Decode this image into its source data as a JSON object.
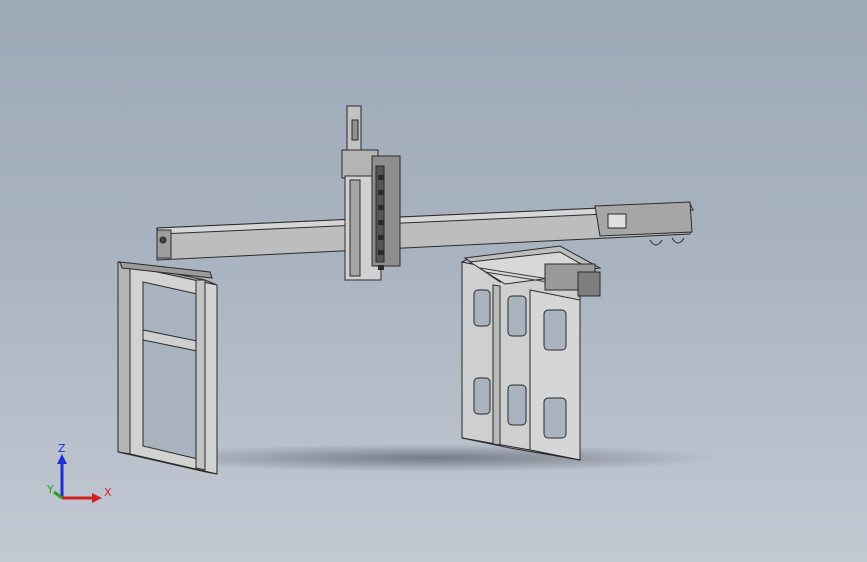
{
  "view": {
    "background_top": "#9ea9b7",
    "background_bottom": "#c3c9d3",
    "model_fill": "#c8c8c8",
    "model_edge": "#2a2a2a"
  },
  "triad": {
    "x_label": "X",
    "y_label": "Y",
    "z_label": "Z",
    "x_color": "#d42020",
    "y_color": "#2aa02a",
    "z_color": "#1f2fd0"
  }
}
